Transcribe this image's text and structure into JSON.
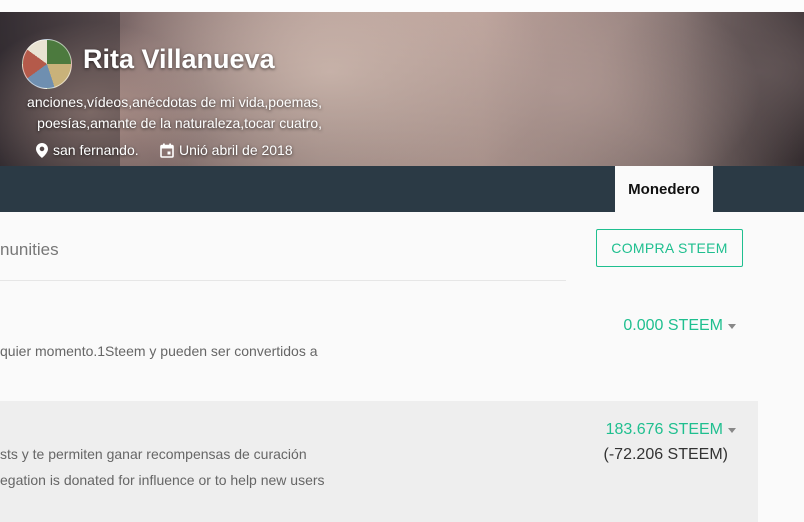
{
  "profile": {
    "name": "Rita Villanueva",
    "about_line1": "anciones,vídeos,anécdotas de mi vida,poemas,",
    "about_line2": "poesías,amante de la naturaleza,tocar cuatro,",
    "location": "san fernando.",
    "joined": "Unió abril de 2018"
  },
  "nav": {
    "active_tab": "Monedero"
  },
  "wallet": {
    "section_label": "nunities",
    "buy_button": "COMPRA STEEM",
    "steem": {
      "description": "quier momento.1Steem y pueden ser convertidos a",
      "amount": "0.000 STEEM"
    },
    "steem_power": {
      "description_line1": "sts y te permiten ganar recompensas de curación",
      "description_line2": "egation is donated for influence or to help new users",
      "amount": "183.676 STEEM",
      "delegated": "(-72.206 STEEM)"
    }
  },
  "icons": {
    "location": "location-pin-icon",
    "calendar": "calendar-icon",
    "caret": "caret-down-icon"
  },
  "colors": {
    "accent": "#1fbf8f",
    "navbar": "#2b3a45"
  }
}
